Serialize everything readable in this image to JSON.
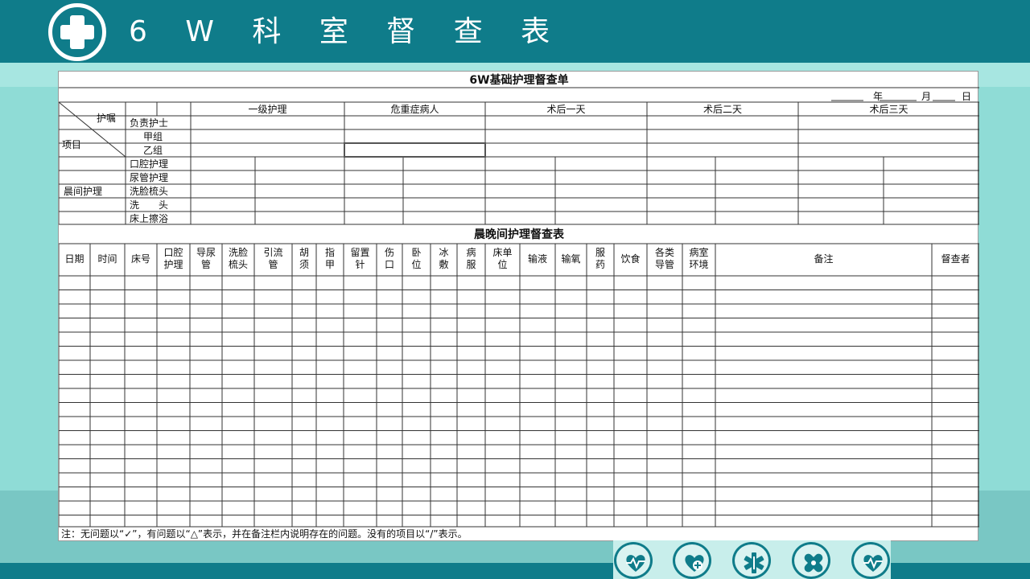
{
  "header": {
    "title": "6 W 科 室 督 查 表"
  },
  "sheet": {
    "title": "6W基础护理督查单",
    "date_labels": [
      "年",
      "月",
      "日"
    ],
    "corner_top": "护嘱",
    "corner_bottom": "项目",
    "groups": [
      "一级护理",
      "危重症病人",
      "术后一天",
      "术后二天",
      "术后三天"
    ],
    "shift_rows": [
      "负责护士",
      "甲组",
      "乙组"
    ],
    "morning_label": "晨间护理",
    "morning_items": [
      "口腔护理",
      "尿管护理",
      "洗脸梳头",
      "洗　　头",
      "床上擦浴"
    ],
    "section2_title": "晨晚间护理督查表",
    "columns": [
      "日期",
      "时间",
      "床号",
      "口腔|护理",
      "导尿|管",
      "洗脸|梳头",
      "引流|管",
      "胡|须",
      "指|甲",
      "留置|针",
      "伤|口",
      "卧|位",
      "冰|敷",
      "病|服",
      "床单|位",
      "输液",
      "输氧",
      "服|药",
      "饮食",
      "各类|导管",
      "病室|环境",
      "备注",
      "督查者"
    ],
    "note": "注：无问题以“✓”，有问题以“△”表示，并在备注栏内说明存在的问题。没有的项目以“/”表示。"
  },
  "footer": {
    "icons": [
      "heart-pulse-icon",
      "heart-plus-icon",
      "medical-star-icon",
      "bandage-icon",
      "heart-pulse-icon"
    ]
  }
}
